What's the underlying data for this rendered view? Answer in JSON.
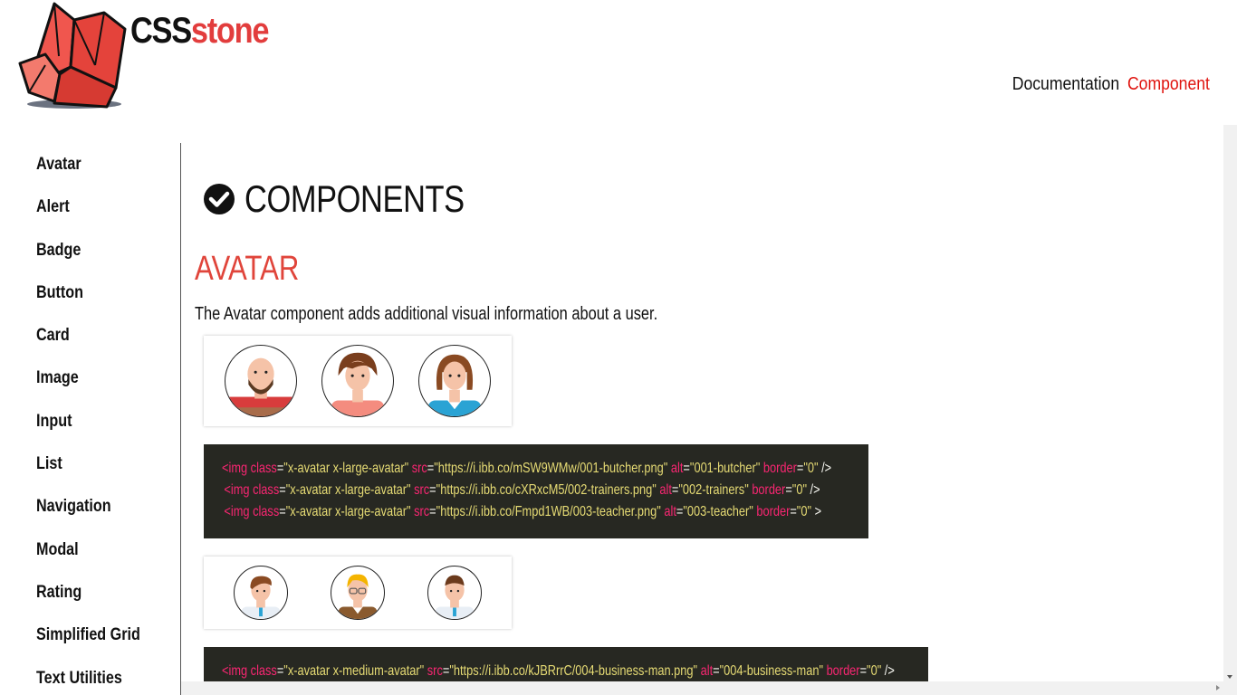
{
  "brand": {
    "part1": "CSS",
    "part2": "stone"
  },
  "topnav": {
    "items": [
      {
        "label": "Documentation"
      },
      {
        "label": "Component"
      }
    ]
  },
  "sidebar": {
    "items": [
      {
        "label": "Avatar"
      },
      {
        "label": "Alert"
      },
      {
        "label": "Badge"
      },
      {
        "label": "Button"
      },
      {
        "label": "Card"
      },
      {
        "label": "Image"
      },
      {
        "label": "Input"
      },
      {
        "label": "List"
      },
      {
        "label": "Navigation"
      },
      {
        "label": "Modal"
      },
      {
        "label": "Rating"
      },
      {
        "label": "Simplified Grid"
      },
      {
        "label": "Text Utilities"
      }
    ]
  },
  "main": {
    "heading": "COMPONENTS",
    "section_title": "AVATAR",
    "section_desc": "The Avatar component adds additional visual information about a user."
  },
  "code1": [
    {
      "tag": "<img",
      "cls_attr": "class",
      "cls_val": "\"x-avatar x-large-avatar\"",
      "src_attr": "src",
      "src_val": "\"https://i.ibb.co/mSW9WMw/001-butcher.png\"",
      "alt_attr": "alt",
      "alt_val": "\"001-butcher\"",
      "border_attr": "border",
      "border_val": "\"0\"",
      "end": " />"
    },
    {
      "tag": "<img",
      "cls_attr": "class",
      "cls_val": "\"x-avatar x-large-avatar\"",
      "src_attr": "src",
      "src_val": "\"https://i.ibb.co/cXRxcM5/002-trainers.png\"",
      "alt_attr": "alt",
      "alt_val": "\"002-trainers\"",
      "border_attr": "border",
      "border_val": "\"0\"",
      "end": " />"
    },
    {
      "tag": "<img",
      "cls_attr": "class",
      "cls_val": "\"x-avatar x-large-avatar\"",
      "src_attr": "src",
      "src_val": "\"https://i.ibb.co/Fmpd1WB/003-teacher.png\"",
      "alt_attr": "alt",
      "alt_val": "\"003-teacher\"",
      "border_attr": "border",
      "border_val": "\"0\"",
      "end": " >"
    }
  ],
  "code2": [
    {
      "tag": "<img",
      "cls_attr": "class",
      "cls_val": "\"x-avatar x-medium-avatar\"",
      "src_attr": "src",
      "src_val": "\"https://i.ibb.co/kJBRrrC/004-business-man.png\"",
      "alt_attr": "alt",
      "alt_val": "\"004-business-man\"",
      "border_attr": "border",
      "border_val": "\"0\"",
      "end": " />"
    }
  ],
  "icons": {
    "logo": "crystal-logo-icon",
    "heading": "check-circle-icon"
  },
  "colors": {
    "accent": "#e0453b",
    "nav_active": "#e0140f",
    "code_bg": "#272822",
    "code_keyword": "#f92672",
    "code_string": "#e6db74"
  }
}
